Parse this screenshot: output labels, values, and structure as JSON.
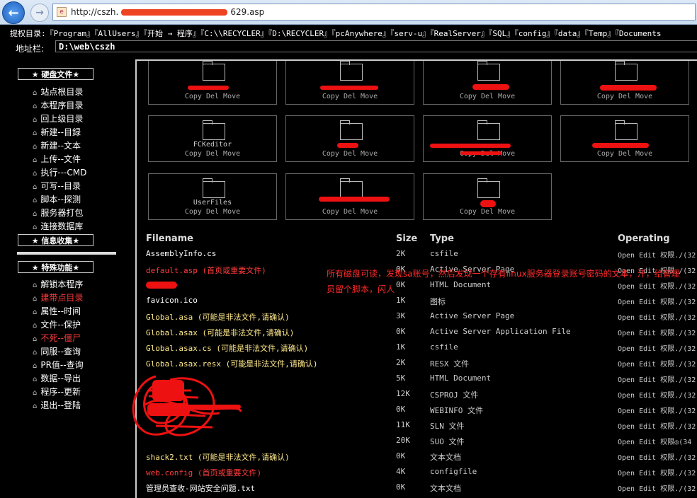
{
  "browser": {
    "url_prefix": "http://cszh.",
    "url_suffix": "629.asp"
  },
  "rights_line": "提权目录:『Program』『AllUsers』『开始 → 程序』『C:\\\\RECYCLER』『D:\\RECYCLER』『pcAnywhere』『serv-u』『RealServer』『SQL』『config』『data』『Temp』『Documents",
  "address": {
    "label": "地址栏:",
    "value": "D:\\web\\cszh"
  },
  "menu": {
    "disk_header": "★ 硬盘文件★",
    "disk_items": [
      "站点根目录",
      "本程序目录",
      "回上级目录",
      "新建--目録",
      "新建--文本",
      "上传--文件",
      "执行---CMD",
      "可写--目录",
      "脚本--探测",
      "服务器打包",
      "连接数据库"
    ],
    "info_header": "★ 信息收集★",
    "special_header": "★ 特殊功能★",
    "special_items": [
      {
        "label": "解锁本程序",
        "red": false
      },
      {
        "label": "建带点目录",
        "red": true
      },
      {
        "label": "属性--时间",
        "red": false
      },
      {
        "label": "文件--保护",
        "red": false
      },
      {
        "label": "不死--僵尸",
        "red": true
      },
      {
        "label": "同服--查询",
        "red": false
      },
      {
        "label": "PR值--查询",
        "red": false
      },
      {
        "label": "数据--导出",
        "red": false
      },
      {
        "label": "程序--更新",
        "red": false
      },
      {
        "label": "退出--登陆",
        "red": false
      }
    ],
    "bullet_icon": "person-icon"
  },
  "folders": [
    {
      "name": "",
      "actions": "Copy Del Move"
    },
    {
      "name": "",
      "actions": "Copy Del Move"
    },
    {
      "name": "",
      "actions": "Copy Del Move"
    },
    {
      "name": "",
      "actions": "Copy Del Move"
    },
    {
      "name": "FCKeditor",
      "actions": "Copy Del Move"
    },
    {
      "name": "",
      "actions": "Copy Del Move"
    },
    {
      "name": "",
      "actions": "Copy Del Move"
    },
    {
      "name": "",
      "actions": "Copy Del Move"
    },
    {
      "name": "UserFiles",
      "actions": "Copy Del Move"
    },
    {
      "name": "",
      "actions": "Copy Del Move"
    },
    {
      "name": "",
      "actions": "Copy Del Move"
    }
  ],
  "table": {
    "headers": {
      "name": "Filename",
      "size": "Size",
      "type": "Type",
      "op": "Operating"
    },
    "rows": [
      {
        "name": "AssemblyInfo.cs",
        "size": "2K",
        "type": "csfile",
        "op": "Open Edit 权限./(32",
        "color": "white"
      },
      {
        "name": "default.asp (首页或重要文件)",
        "size": "0K",
        "type": "Active Server Page",
        "op": "Open Edit 权限./(32",
        "color": "red"
      },
      {
        "name": "",
        "size": "0K",
        "type": "HTML Document",
        "op": "Open Edit 权限./(32",
        "color": "white"
      },
      {
        "name": "favicon.ico",
        "size": "1K",
        "type": "图标",
        "op": "Open Edit 权限./(32",
        "color": "white"
      },
      {
        "name": "Global.asa (可能是非法文件,请确认)",
        "size": "3K",
        "type": "Active Server Page",
        "op": "Open Edit 权限./(32",
        "color": "yellow"
      },
      {
        "name": "Global.asax (可能是非法文件,请确认)",
        "size": "0K",
        "type": "Active Server Application File",
        "op": "Open Edit 权限./(32",
        "color": "yellow"
      },
      {
        "name": "Global.asax.cs (可能是非法文件,请确认)",
        "size": "1K",
        "type": "csfile",
        "op": "Open Edit 权限./(32",
        "color": "yellow"
      },
      {
        "name": "Global.asax.resx (可能是非法文件,请确认)",
        "size": "2K",
        "type": "RESX 文件",
        "op": "Open Edit 权限./(32",
        "color": "yellow"
      },
      {
        "name": "",
        "size": "5K",
        "type": "HTML Document",
        "op": "Open Edit 权限./(32",
        "color": "white"
      },
      {
        "name": "",
        "size": "12K",
        "type": "CSPROJ 文件",
        "op": "Open Edit 权限./(32",
        "color": "white"
      },
      {
        "name": "",
        "size": "0K",
        "type": "WEBINFO 文件",
        "op": "Open Edit 权限./(32",
        "color": "white"
      },
      {
        "name": "",
        "size": "11K",
        "type": "SLN 文件",
        "op": "Open Edit 权限./(32",
        "color": "white"
      },
      {
        "name": "",
        "size": "20K",
        "type": "SUO 文件",
        "op": "Open Edit 权限◎(34",
        "color": "white"
      },
      {
        "name": "shack2.txt (可能是非法文件,请确认)",
        "size": "0K",
        "type": "文本文档",
        "op": "Open Edit 权限./(32",
        "color": "yellow"
      },
      {
        "name": "web.config (首页或重要文件)",
        "size": "4K",
        "type": "configfile",
        "op": "Open Edit 权限./(32",
        "color": "red"
      },
      {
        "name": "管理员查收-网站安全问题.txt",
        "size": "0K",
        "type": "文本文档",
        "op": "Open Edit 权限./(32",
        "color": "white"
      }
    ]
  },
  "annotation_note": "所有磁盘可读，发现sa账号，然后发现一个存有linux服务器登录账号密码的文本，汗，给管理员留个脚本，闪人"
}
